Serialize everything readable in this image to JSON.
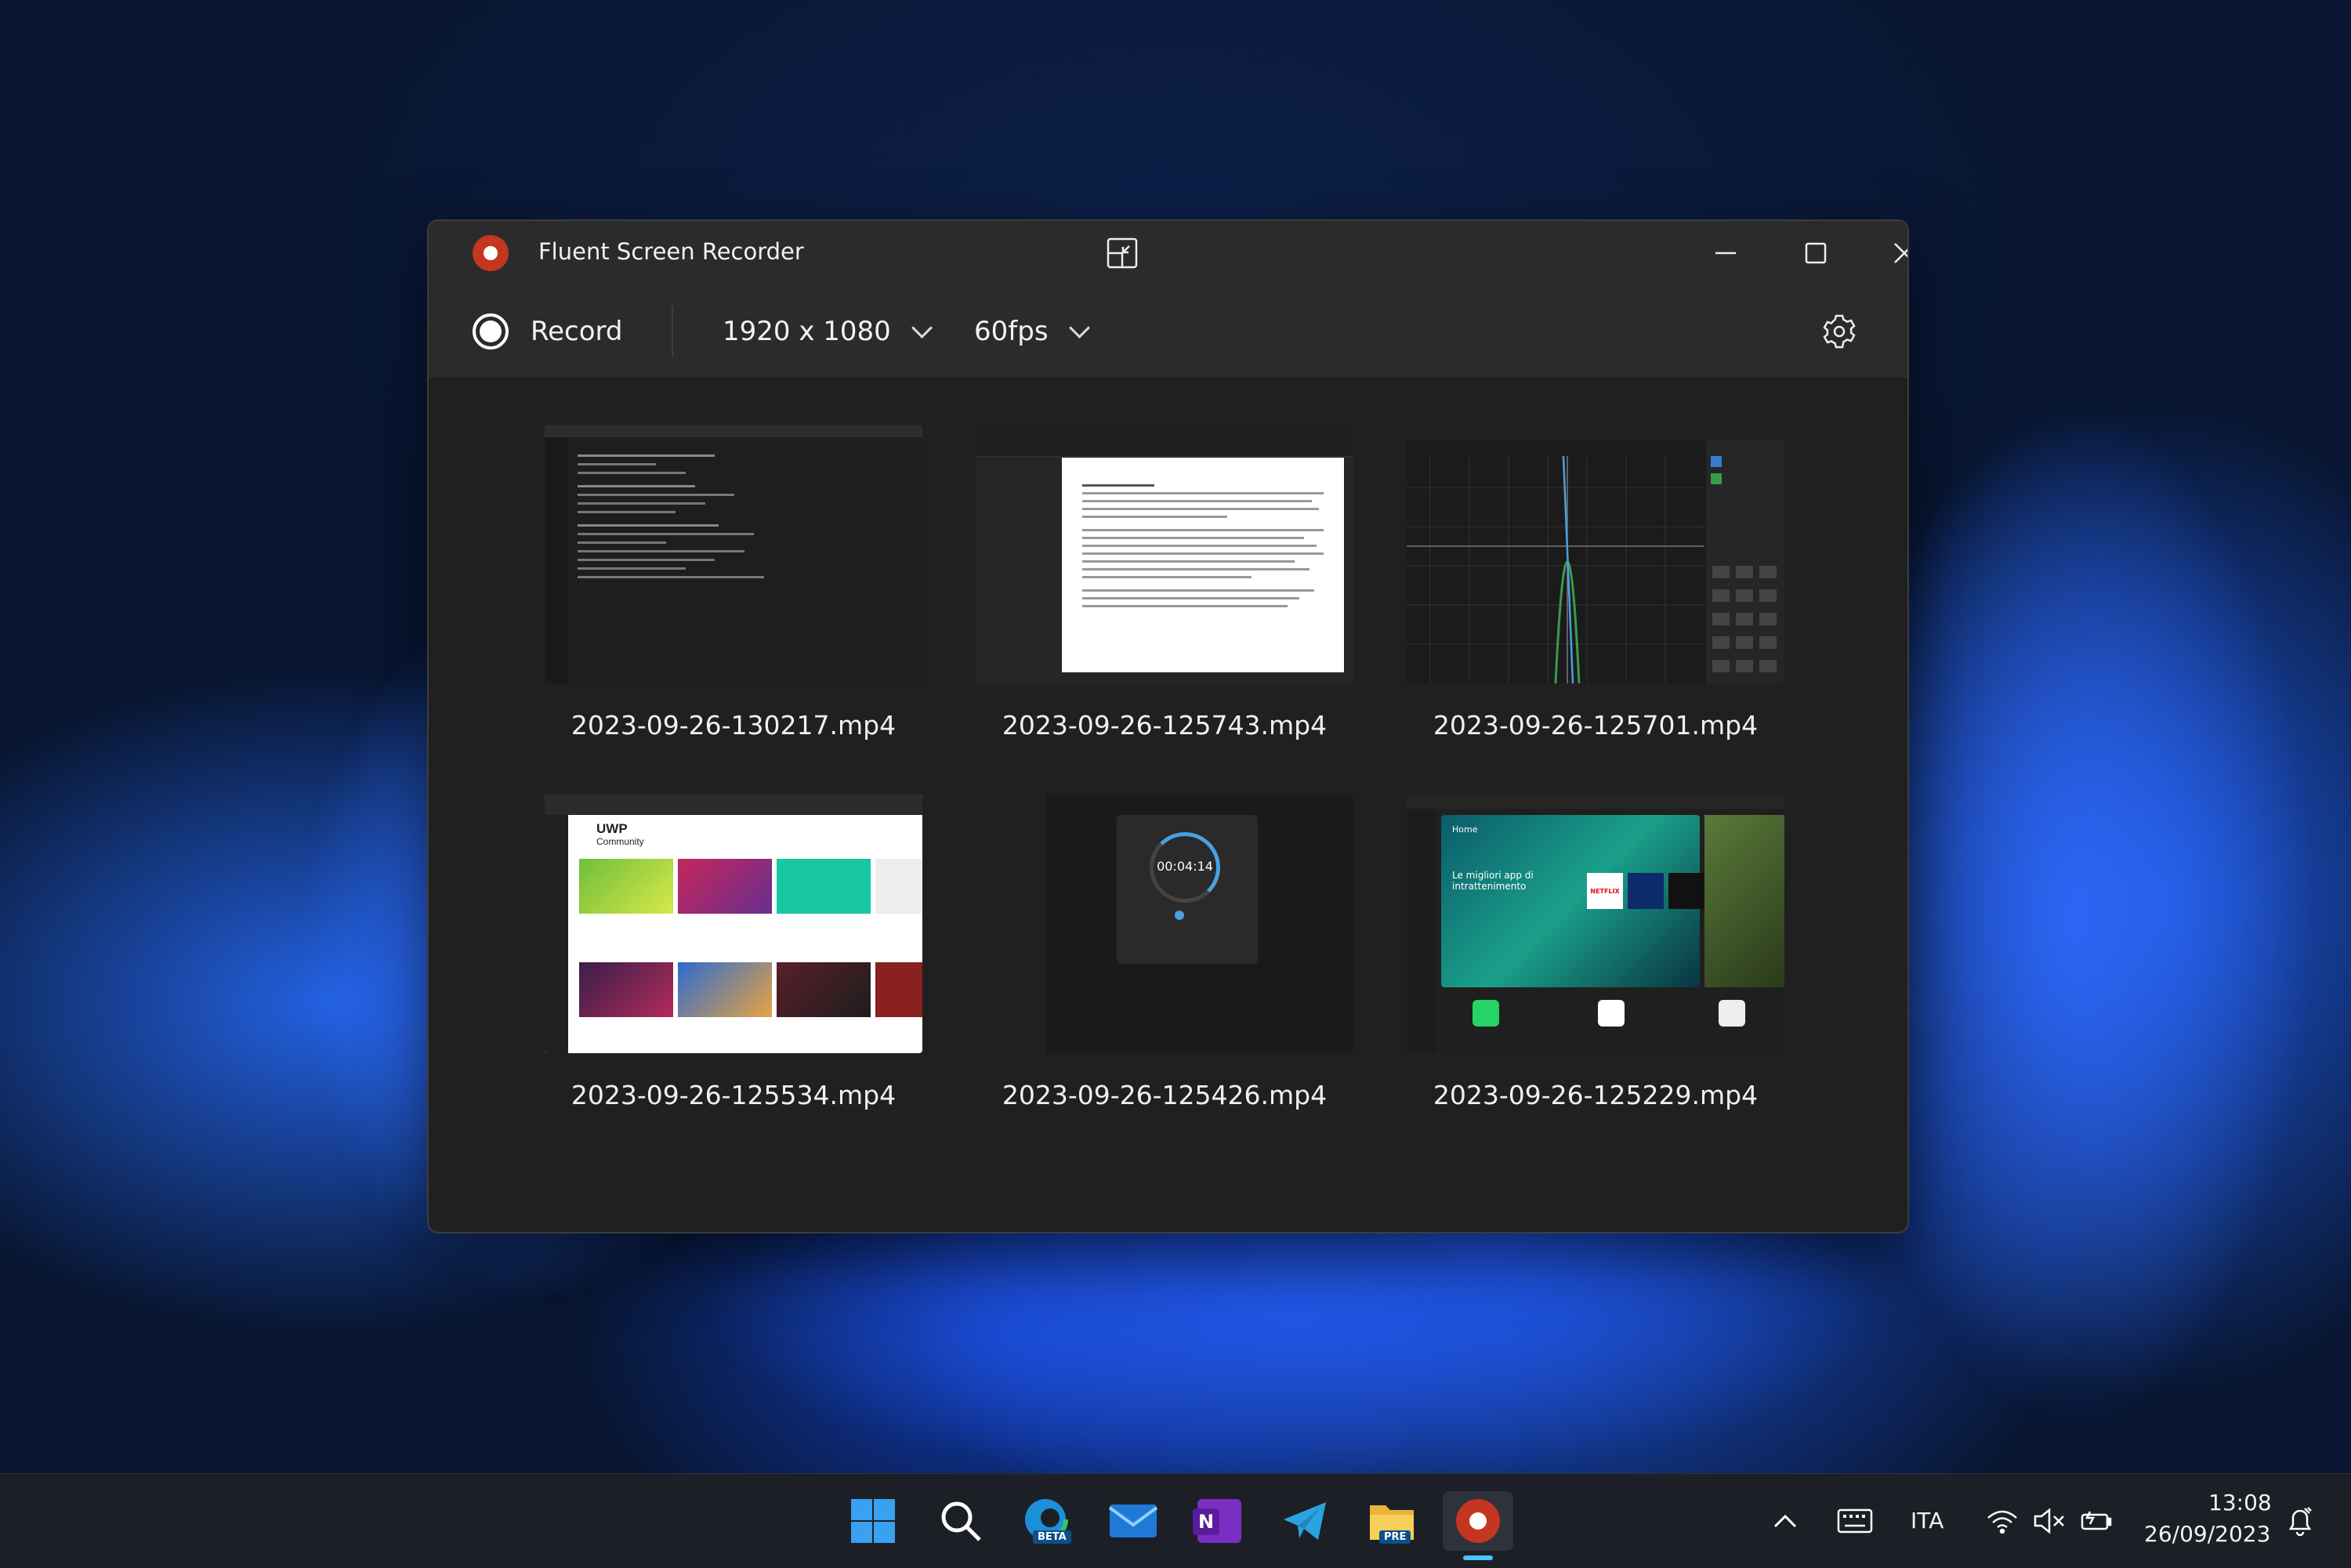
{
  "window": {
    "title": "Fluent Screen Recorder",
    "buttons": {
      "compact": "compact-overlay",
      "minimize": "–",
      "maximize": "☐",
      "close": "✕"
    }
  },
  "toolbar": {
    "record_label": "Record",
    "resolution": "1920 x 1080",
    "framerate": "60fps"
  },
  "recordings": [
    {
      "file": "2023-09-26-130217.mp4",
      "preview": "code-editor"
    },
    {
      "file": "2023-09-26-125743.mp4",
      "preview": "word-document"
    },
    {
      "file": "2023-09-26-125701.mp4",
      "preview": "calculator-graph"
    },
    {
      "file": "2023-09-26-125534.mp4",
      "preview": "uwp-community-website"
    },
    {
      "file": "2023-09-26-125426.mp4",
      "preview": "timer",
      "timer_text": "00:04:14"
    },
    {
      "file": "2023-09-26-125229.mp4",
      "preview": "microsoft-store"
    }
  ],
  "previews": {
    "uwp_logo": "UWP",
    "uwp_sub": "Community",
    "store_home": "Home",
    "store_headline": "Le migliori app di intrattenimento",
    "netflix": "NETFLIX"
  },
  "taskbar": {
    "icons": [
      "windows-start-icon",
      "search-icon",
      "edge-beta-icon",
      "mail-icon",
      "onenote-icon",
      "telegram-icon",
      "file-explorer-preview-icon",
      "fluent-screen-recorder-icon"
    ],
    "edge_badge": "BETA",
    "explorer_badge": "PRE",
    "onenote_letter": "N",
    "language": "ITA",
    "time": "13:08",
    "date": "26/09/2023"
  },
  "colors": {
    "accent": "#c4361f",
    "window_bg": "#202020",
    "titlebar_bg": "#2b2b2b"
  }
}
